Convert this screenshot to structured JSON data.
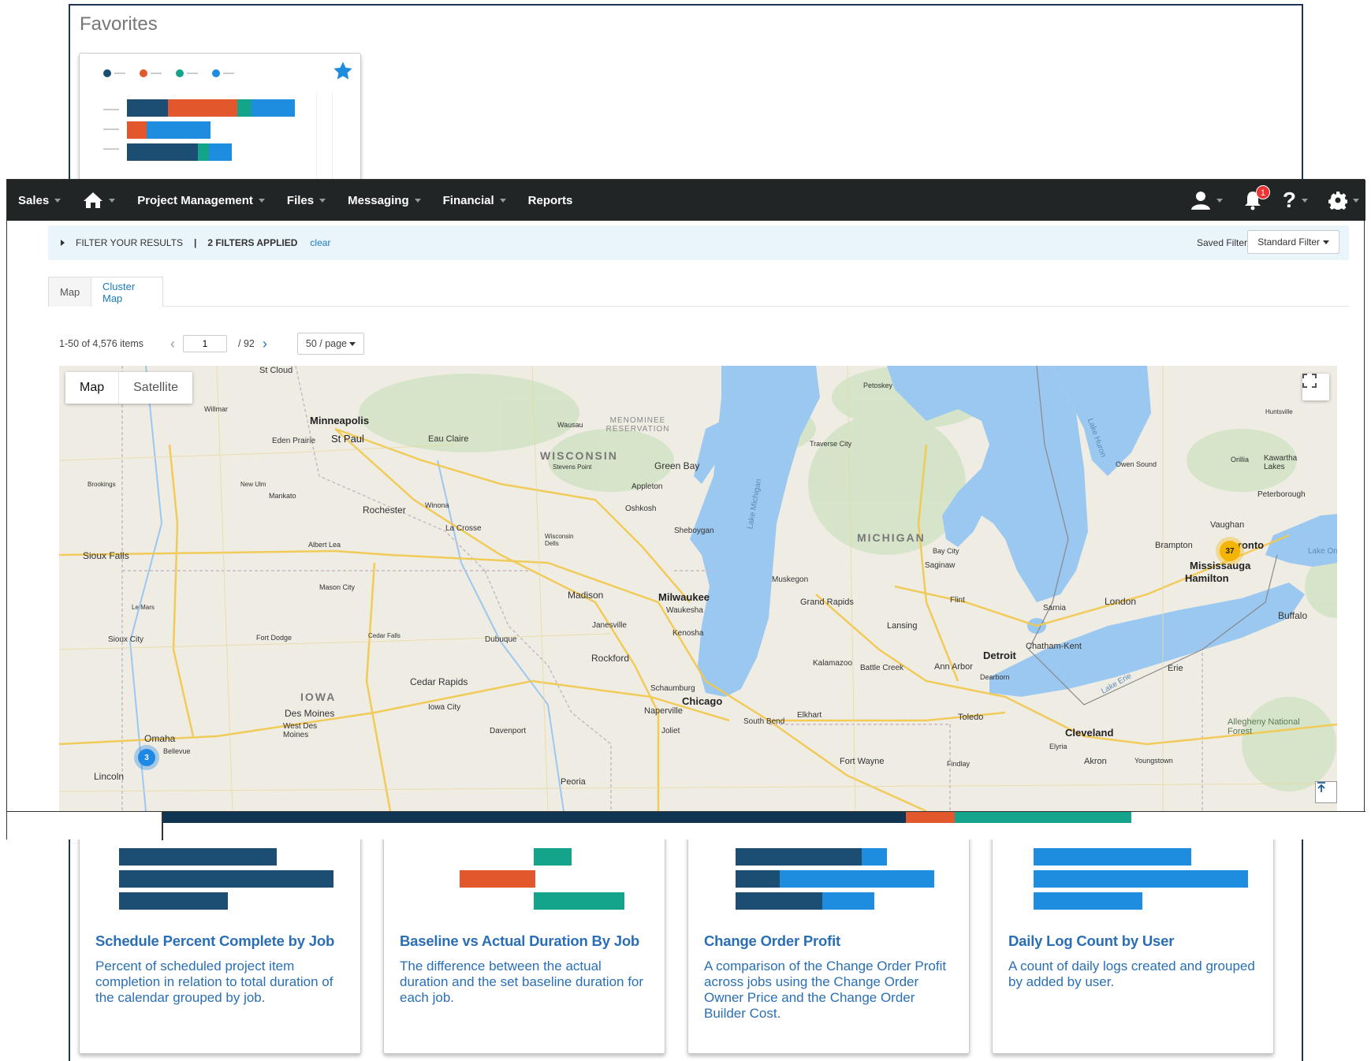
{
  "favorites": {
    "title": "Favorites"
  },
  "cards": [
    {
      "title": "Schedule Percent Complete by Job",
      "description": "Percent of scheduled project item completion in relation to total duration of the calendar grouped by job."
    },
    {
      "title": "Baseline vs Actual Duration By Job",
      "description": "The difference between the actual duration and the set baseline duration for each job."
    },
    {
      "title": "Change Order Profit",
      "description": "A comparison of the Change Order Profit across jobs using the Change Order Owner Price and the Change Order Builder Cost."
    },
    {
      "title": "Daily Log Count by User",
      "description": "A count of daily logs created and grouped by added by user."
    }
  ],
  "nav": {
    "items": [
      "Sales",
      "Project Management",
      "Files",
      "Messaging",
      "Financial",
      "Reports"
    ],
    "notification_count": "1",
    "icons": [
      "home-icon",
      "user-icon",
      "bell-icon",
      "help-icon",
      "gear-icon"
    ]
  },
  "filter": {
    "label": "FILTER YOUR RESULTS",
    "separator": "|",
    "applied": "2 FILTERS APPLIED",
    "clear": "clear",
    "saved_label": "Saved Filters",
    "standard": "Standard Filter"
  },
  "tabs": [
    "Map",
    "Cluster Map"
  ],
  "pager": {
    "range": "1-50 of 4,576 items",
    "current": "1",
    "total": "/ 92",
    "per_page": "50 / page"
  },
  "map": {
    "toggle": [
      "Map",
      "Satellite"
    ],
    "clusters": [
      {
        "count": "37",
        "color": "#f5b400"
      },
      {
        "count": "3",
        "color": "#1e88e5"
      }
    ],
    "labels": {
      "big": [
        "Minneapolis",
        "St Paul",
        "Milwaukee",
        "Chicago",
        "Detroit",
        "Mississauga",
        "Hamilton",
        "Toronto",
        "Cleveland"
      ],
      "cities": [
        "St Cloud",
        "Eden Prairie",
        "Eau Claire",
        "Rochester",
        "La Crosse",
        "Green Bay",
        "Appleton",
        "Oshkosh",
        "Sheboygan",
        "Madison",
        "Waukesha",
        "Janesville",
        "Kenosha",
        "Rockford",
        "Dubuque",
        "Cedar Rapids",
        "Iowa City",
        "Davenport",
        "Des Moines",
        "West Des Moines",
        "Sioux Falls",
        "Sioux City",
        "Omaha",
        "Bellevue",
        "Lincoln",
        "Peoria",
        "Joliet",
        "Naperville",
        "Schaumburg",
        "South Bend",
        "Elkhart",
        "Fort Wayne",
        "Toledo",
        "Ann Arbor",
        "Dearborn",
        "Lansing",
        "Grand Rapids",
        "Kalamazoo",
        "Battle Creek",
        "Muskegon",
        "Flint",
        "Saginaw",
        "Bay City",
        "Traverse City",
        "Petoskey",
        "London",
        "Sarnia",
        "Chatham-Kent",
        "Buffalo",
        "Erie",
        "Akron",
        "Youngstown",
        "Elyria",
        "Findlay",
        "Brampton",
        "Vaughan",
        "Peterborough",
        "Kawartha Lakes",
        "Orillia",
        "Owen Sound",
        "Huntsville",
        "Mankato",
        "Albert Lea",
        "Mason City",
        "Fort Dodge",
        "Cedar Falls",
        "Winona",
        "Wausau",
        "New Ulm",
        "Brookings",
        "Willmar",
        "Le Mars",
        "Wisconsin Dells",
        "Stevens Point",
        "Allegheny National Forest"
      ],
      "states": [
        "WISCONSIN",
        "MICHIGAN",
        "IOWA"
      ],
      "water": [
        "Lake Michigan",
        "Lake Huron",
        "Lake Erie",
        "Lake On"
      ],
      "reserve": "MENOMINEE RESERVATION"
    }
  },
  "colors": {
    "navy": "#1c4e73",
    "orange": "#e2572b",
    "teal": "#14a38b",
    "blue": "#1e8de0",
    "link": "#1a7bbf",
    "nav_bg": "#222526"
  }
}
